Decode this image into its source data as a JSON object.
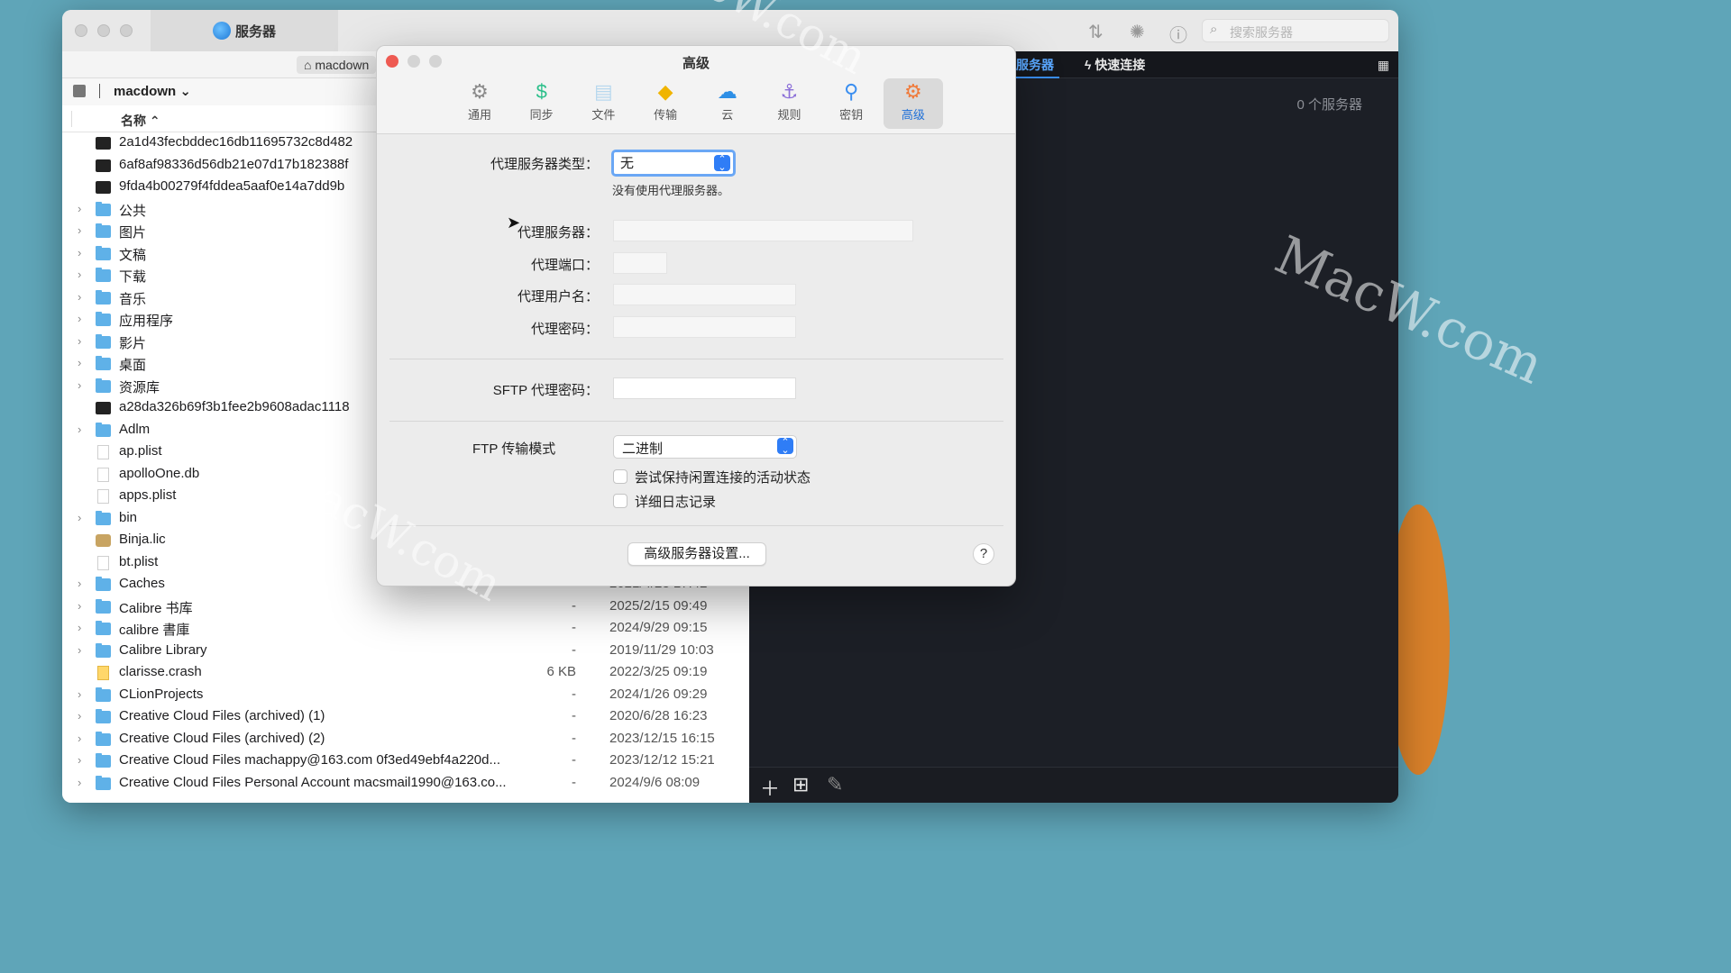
{
  "window": {
    "tab_title": "服务器",
    "search_placeholder": "搜索服务器"
  },
  "left_pane": {
    "path_chip": "macdown",
    "folder_name": "macdown",
    "column_name": "名称",
    "files": [
      {
        "name": "2a1d43fecbddec16db11695732c8d482",
        "icon": "terminal",
        "expandable": false,
        "size": "",
        "date": ""
      },
      {
        "name": "6af8af98336d56db21e07d17b182388f",
        "icon": "terminal",
        "expandable": false,
        "size": "",
        "date": ""
      },
      {
        "name": "9fda4b00279f4fddea5aaf0e14a7dd9b",
        "icon": "terminal",
        "expandable": false,
        "size": "",
        "date": ""
      },
      {
        "name": "公共",
        "icon": "folder",
        "expandable": true,
        "size": "",
        "date": ""
      },
      {
        "name": "图片",
        "icon": "folder",
        "expandable": true,
        "size": "",
        "date": ""
      },
      {
        "name": "文稿",
        "icon": "folder",
        "expandable": true,
        "size": "",
        "date": ""
      },
      {
        "name": "下载",
        "icon": "folder",
        "expandable": true,
        "size": "",
        "date": ""
      },
      {
        "name": "音乐",
        "icon": "folder",
        "expandable": true,
        "size": "",
        "date": ""
      },
      {
        "name": "应用程序",
        "icon": "folder",
        "expandable": true,
        "size": "",
        "date": ""
      },
      {
        "name": "影片",
        "icon": "folder",
        "expandable": true,
        "size": "",
        "date": ""
      },
      {
        "name": "桌面",
        "icon": "folder",
        "expandable": true,
        "size": "",
        "date": ""
      },
      {
        "name": "资源库",
        "icon": "folder",
        "expandable": true,
        "size": "",
        "date": ""
      },
      {
        "name": "a28da326b69f3b1fee2b9608adac1118",
        "icon": "terminal",
        "expandable": false,
        "size": "",
        "date": ""
      },
      {
        "name": "Adlm",
        "icon": "folder",
        "expandable": true,
        "size": "",
        "date": ""
      },
      {
        "name": "ap.plist",
        "icon": "doc",
        "expandable": false,
        "size": "",
        "date": ""
      },
      {
        "name": "apolloOne.db",
        "icon": "doc",
        "expandable": false,
        "size": "",
        "date": ""
      },
      {
        "name": "apps.plist",
        "icon": "doc",
        "expandable": false,
        "size": "",
        "date": ""
      },
      {
        "name": "bin",
        "icon": "folder",
        "expandable": true,
        "size": "",
        "date": ""
      },
      {
        "name": "Binja.lic",
        "icon": "lic",
        "expandable": false,
        "size": "",
        "date": ""
      },
      {
        "name": "bt.plist",
        "icon": "doc",
        "expandable": false,
        "size": "",
        "date": ""
      },
      {
        "name": "Caches",
        "icon": "folder",
        "expandable": true,
        "size": "-",
        "date": "2021/4/23 17:42"
      },
      {
        "name": "Calibre 书库",
        "icon": "folder",
        "expandable": true,
        "size": "-",
        "date": "2025/2/15 09:49"
      },
      {
        "name": "calibre 書庫",
        "icon": "folder",
        "expandable": true,
        "size": "-",
        "date": "2024/9/29 09:15"
      },
      {
        "name": "Calibre Library",
        "icon": "folder",
        "expandable": true,
        "size": "-",
        "date": "2019/11/29 10:03"
      },
      {
        "name": "clarisse.crash",
        "icon": "crash",
        "expandable": false,
        "size": "6 KB",
        "date": "2022/3/25 09:19"
      },
      {
        "name": "CLionProjects",
        "icon": "folder",
        "expandable": true,
        "size": "-",
        "date": "2024/1/26 09:29"
      },
      {
        "name": "Creative Cloud Files (archived) (1)",
        "icon": "folder",
        "expandable": true,
        "size": "-",
        "date": "2020/6/28 16:23"
      },
      {
        "name": "Creative Cloud Files (archived) (2)",
        "icon": "folder",
        "expandable": true,
        "size": "-",
        "date": "2023/12/15 16:15"
      },
      {
        "name": "Creative Cloud Files machappy@163.com 0f3ed49ebf4a220d...",
        "icon": "folder",
        "expandable": true,
        "size": "-",
        "date": "2023/12/12 15:21"
      },
      {
        "name": "Creative Cloud Files Personal Account macsmail1990@163.co...",
        "icon": "folder",
        "expandable": true,
        "size": "-",
        "date": "2024/9/6 08:09"
      }
    ]
  },
  "right_pane": {
    "tab_servers": "服务器",
    "tab_quick": "快速连接",
    "count_label": "0 个服务器"
  },
  "dialog": {
    "title": "高级",
    "tabs": [
      {
        "label": "通用",
        "icon": "gear-icon",
        "color": "#8a8a8a"
      },
      {
        "label": "同步",
        "icon": "sync-icon",
        "color": "#2bbf8a"
      },
      {
        "label": "文件",
        "icon": "file-icon",
        "color": "#b8d8ee"
      },
      {
        "label": "传输",
        "icon": "transfer-icon",
        "color": "#f0b400"
      },
      {
        "label": "云",
        "icon": "cloud-icon",
        "color": "#2e8fe6"
      },
      {
        "label": "规则",
        "icon": "rules-icon",
        "color": "#8b6fd8"
      },
      {
        "label": "密钥",
        "icon": "key-icon",
        "color": "#3a8ef0"
      },
      {
        "label": "高级",
        "icon": "advanced-gear-icon",
        "color": "#f07a3a"
      }
    ],
    "proxy_type_label": "代理服务器类型：",
    "proxy_type_value": "无",
    "proxy_type_hint": "没有使用代理服务器。",
    "proxy_server_label": "代理服务器：",
    "proxy_port_label": "代理端口：",
    "proxy_user_label": "代理用户名：",
    "proxy_password_label": "代理密码：",
    "sftp_proxy_password_label": "SFTP 代理密码：",
    "ftp_mode_label": "FTP 传输模式",
    "ftp_mode_value": "二进制",
    "keepalive_label": "尝试保持闲置连接的活动状态",
    "verbose_log_label": "详细日志记录",
    "advanced_server_button": "高级服务器设置...",
    "help_button": "?"
  },
  "watermarks": {
    "text": "MacW.com"
  }
}
